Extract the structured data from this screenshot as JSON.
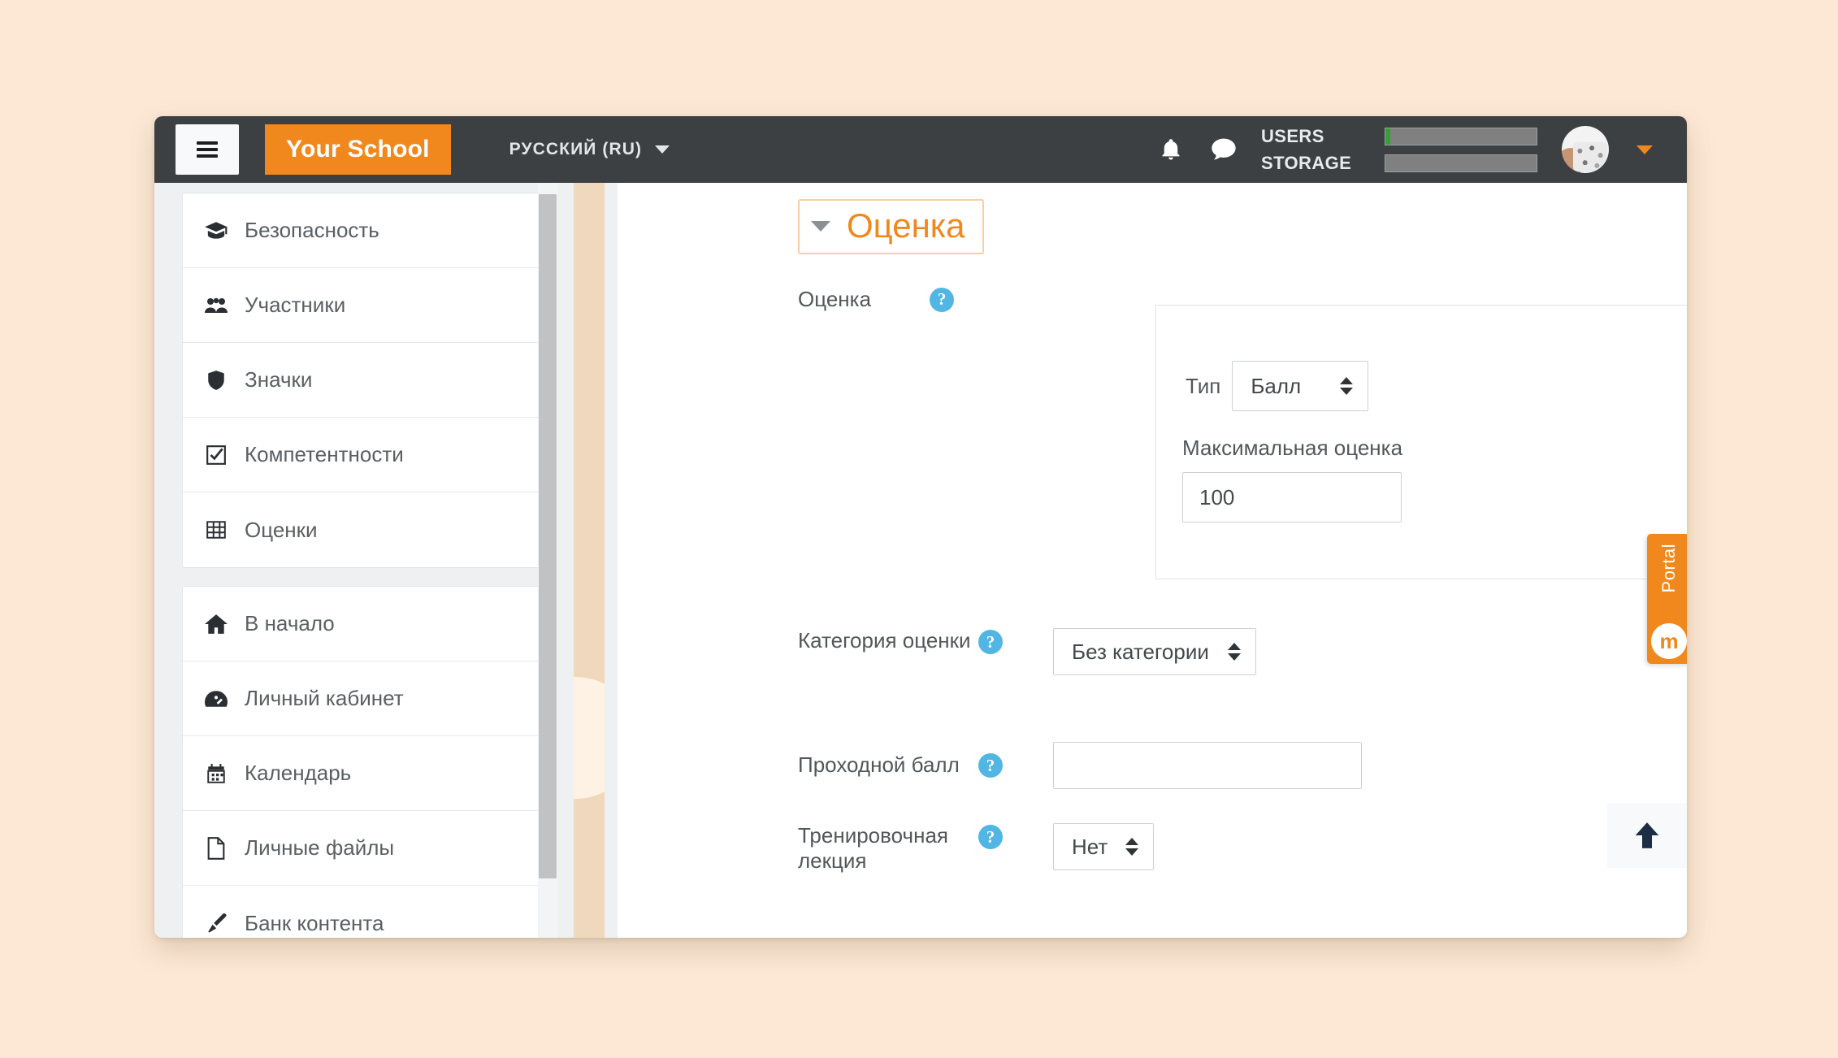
{
  "brand": {
    "name": "Your School",
    "menu_toggle": "Меню"
  },
  "header": {
    "language": "РУССКИЙ (RU)",
    "usage": [
      {
        "label": "USERS",
        "fill_percent": 3
      },
      {
        "label": "STORAGE",
        "fill_percent": 0
      }
    ],
    "icons": {
      "notifications": "bell-icon",
      "messages": "message-icon",
      "avatar": "user-avatar"
    }
  },
  "sidebar": {
    "groups": [
      {
        "items": [
          {
            "label": "Безопасность",
            "icon": "graduation-cap-icon"
          },
          {
            "label": "Участники",
            "icon": "users-icon"
          },
          {
            "label": "Значки",
            "icon": "shield-icon"
          },
          {
            "label": "Компетентности",
            "icon": "check-square-icon"
          },
          {
            "label": "Оценки",
            "icon": "table-icon"
          }
        ]
      },
      {
        "items": [
          {
            "label": "В начало",
            "icon": "home-icon"
          },
          {
            "label": "Личный кабинет",
            "icon": "dashboard-icon"
          },
          {
            "label": "Календарь",
            "icon": "calendar-icon"
          },
          {
            "label": "Личные файлы",
            "icon": "file-icon"
          },
          {
            "label": "Банк контента",
            "icon": "brush-icon"
          }
        ]
      }
    ]
  },
  "main": {
    "section_title": "Оценка",
    "fields": {
      "grade": {
        "label": "Оценка",
        "type_label": "Тип",
        "type_value": "Балл",
        "max_grade_label": "Максимальная оценка",
        "max_grade_value": "100"
      },
      "grade_category": {
        "label": "Категория оценки",
        "value": "Без категории"
      },
      "passing_grade": {
        "label": "Проходной балл",
        "value": "",
        "placeholder": ""
      },
      "practice_lesson": {
        "label": "Тренировочная лекция",
        "value": "Нет"
      }
    },
    "help_glyph": "?"
  },
  "widgets": {
    "portal_tab": "Portal",
    "scroll_top": "scroll-to-top"
  },
  "colors": {
    "brand_orange": "#f0881e",
    "navbar_dark": "#3c4043",
    "page_background": "#fce8d5",
    "help_blue": "#52b6e4",
    "usage_green": "#35a135"
  }
}
